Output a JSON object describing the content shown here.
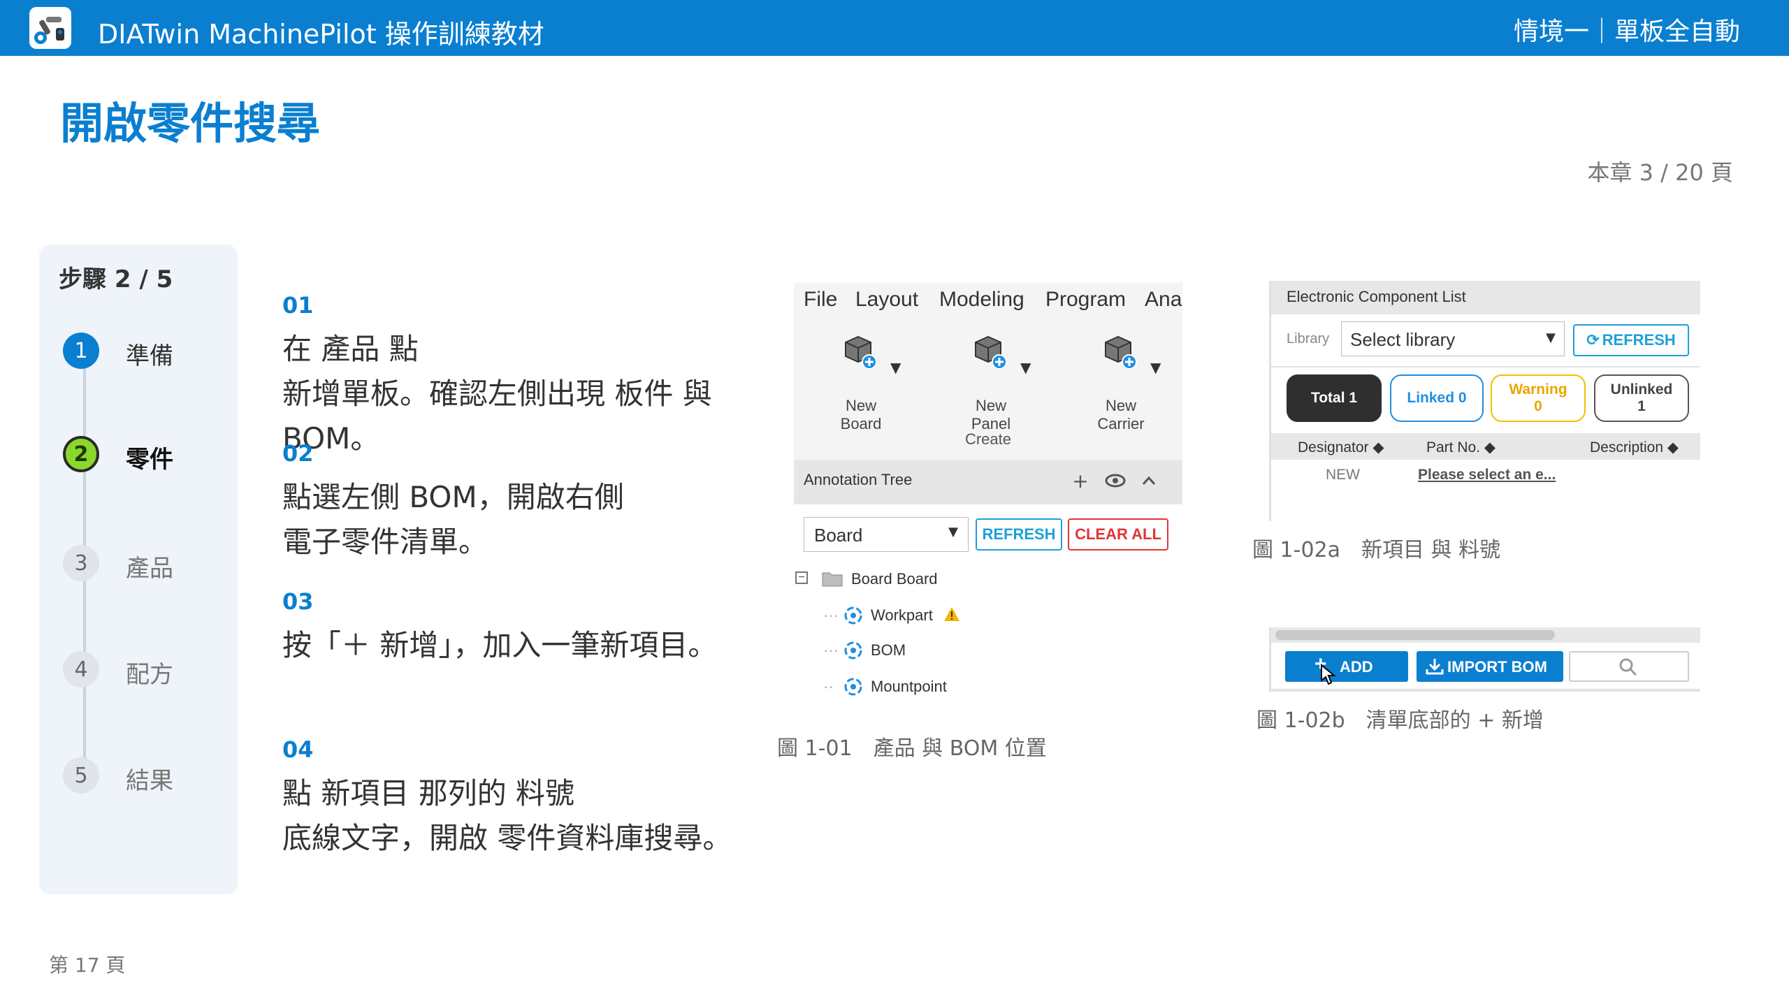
{
  "header": {
    "app_title": "DIATwin MachinePilot 操作訓練教材",
    "scenario": "情境一｜單板全自動"
  },
  "page_title": "開啟零件搜尋",
  "chapter_page": "本章 3 / 20 頁",
  "steps": {
    "header": "步驟 2 / 5",
    "items": [
      {
        "num": "1",
        "label": "準備",
        "state": "done"
      },
      {
        "num": "2",
        "label": "零件",
        "state": "active"
      },
      {
        "num": "3",
        "label": "產品",
        "state": "todo"
      },
      {
        "num": "4",
        "label": "配方",
        "state": "todo"
      },
      {
        "num": "5",
        "label": "結果",
        "state": "todo"
      }
    ]
  },
  "instructions": [
    {
      "num": "01",
      "text": "在 產品 點\n新增單板。確認左側出現 板件 與\nBOM。"
    },
    {
      "num": "02",
      "text": "點選左側 BOM，開啟右側\n電子零件清單。"
    },
    {
      "num": "03",
      "text": "按「＋ 新增」，加入一筆新項目。"
    },
    {
      "num": "04",
      "text": "點 新項目 那列的 料號\n底線文字，開啟 零件資料庫搜尋。"
    }
  ],
  "figure1": {
    "menu": [
      "File",
      "Layout",
      "Modeling",
      "Program",
      "Ana"
    ],
    "ribbon_buttons": [
      {
        "label": "New\nBoard",
        "icon": "cube-plus-icon"
      },
      {
        "label": "New\nPanel",
        "icon": "cube-plus-icon"
      },
      {
        "label": "New\nCarrier",
        "icon": "cube-plus-icon"
      }
    ],
    "ribbon_group": "Create",
    "annotation_title": "Annotation Tree",
    "board_select": "Board",
    "refresh": "REFRESH",
    "clear_all": "CLEAR ALL",
    "tree": {
      "root": "Board  Board",
      "children": [
        "Workpart",
        "BOM",
        "Mountpoint"
      ]
    },
    "caption": "圖 1-01　產品 與 BOM 位置"
  },
  "figure2": {
    "title": "Electronic Component List",
    "library_label": "Library",
    "library_select": "Select library",
    "refresh": "REFRESH",
    "pills": [
      {
        "label": "Total 1",
        "sub": ""
      },
      {
        "label": "Linked 0",
        "sub": ""
      },
      {
        "label": "Warning",
        "sub": "0"
      },
      {
        "label": "Unlinked",
        "sub": "1"
      }
    ],
    "columns": [
      "Designator ◆",
      "Part No. ◆",
      "Description ◆"
    ],
    "row": {
      "designator": "NEW",
      "part": "Please select an e..."
    },
    "caption": "圖 1-02a　新項目 與 料號"
  },
  "figure3": {
    "add": "ADD",
    "import_bom": "IMPORT BOM",
    "caption": "圖 1-02b　清單底部的 + 新增"
  },
  "colors": {
    "primary": "#0a7fd0",
    "active_step": "#8bd82d",
    "refresh": "#1fa0d8",
    "clear_all": "#e03535",
    "warning": "#f2c000"
  },
  "page_number": "第 17 頁"
}
